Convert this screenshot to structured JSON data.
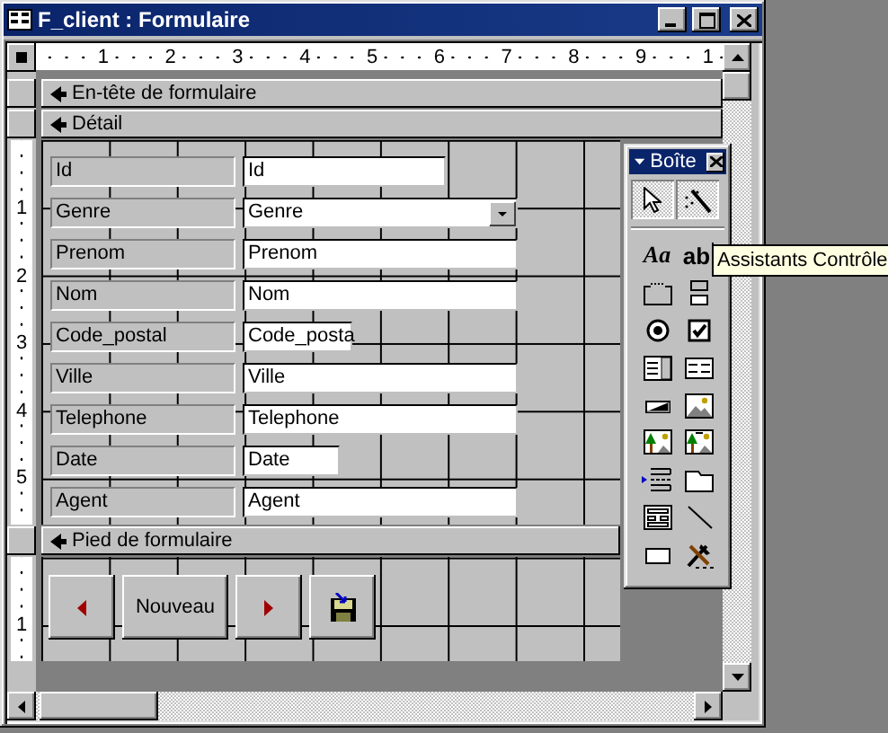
{
  "window": {
    "title": "F_client : Formulaire"
  },
  "ruler": {
    "marks": [
      "1",
      "2",
      "3",
      "4",
      "5",
      "6",
      "7",
      "8",
      "9",
      "1"
    ]
  },
  "header_section": {
    "label": "En-tête de formulaire"
  },
  "detail_section": {
    "label": "Détail",
    "ruler_marks": [
      "1",
      "2",
      "3",
      "4",
      "5"
    ],
    "fields": [
      {
        "label": "Id",
        "control": "Id",
        "kind": "text"
      },
      {
        "label": "Genre",
        "control": "Genre",
        "kind": "combo"
      },
      {
        "label": "Prenom",
        "control": "Prenom",
        "kind": "text"
      },
      {
        "label": "Nom",
        "control": "Nom",
        "kind": "text"
      },
      {
        "label": "Code_postal",
        "control": "Code_posta",
        "kind": "text"
      },
      {
        "label": "Ville",
        "control": "Ville",
        "kind": "text"
      },
      {
        "label": "Telephone",
        "control": "Telephone",
        "kind": "text"
      },
      {
        "label": "Date",
        "control": "Date",
        "kind": "text"
      },
      {
        "label": "Agent",
        "control": "Agent",
        "kind": "text"
      }
    ]
  },
  "footer_section": {
    "label": "Pied de formulaire",
    "ruler_marks": [
      "1"
    ],
    "buttons": [
      {
        "kind": "prev"
      },
      {
        "kind": "text",
        "label": "Nouveau"
      },
      {
        "kind": "next"
      },
      {
        "kind": "save"
      }
    ]
  },
  "toolbox": {
    "title": "Boîte",
    "toggles": [
      {
        "kind": "pointer",
        "selected": true
      },
      {
        "kind": "wizard",
        "selected": true
      }
    ],
    "tools": [
      {
        "kind": "label",
        "glyph": "Aa"
      },
      {
        "kind": "textbox",
        "glyph": "ab"
      },
      {
        "kind": "group"
      },
      {
        "kind": "toggle"
      },
      {
        "kind": "radio"
      },
      {
        "kind": "checkbox"
      },
      {
        "kind": "combo"
      },
      {
        "kind": "list"
      },
      {
        "kind": "button"
      },
      {
        "kind": "image"
      },
      {
        "kind": "unbound"
      },
      {
        "kind": "bound"
      },
      {
        "kind": "pagebreak"
      },
      {
        "kind": "tab"
      },
      {
        "kind": "subform"
      },
      {
        "kind": "line"
      },
      {
        "kind": "rect"
      },
      {
        "kind": "more"
      }
    ],
    "tooltip": "Assistants Contrôle"
  }
}
